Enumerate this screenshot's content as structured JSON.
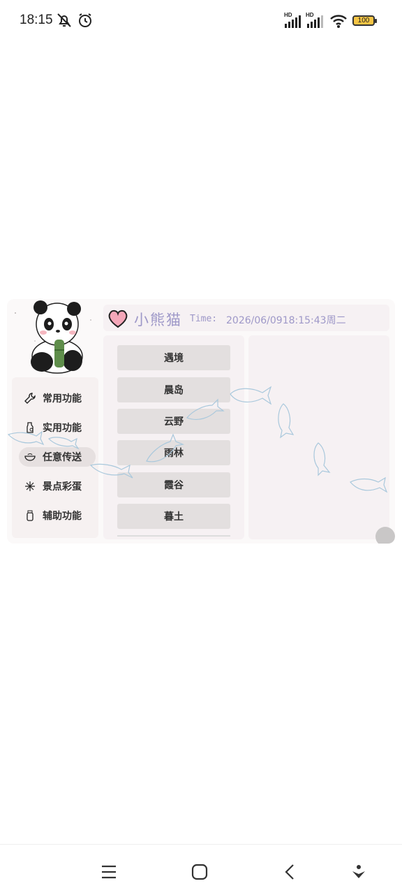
{
  "status_bar": {
    "time": "18:15",
    "hd1": "HD",
    "hd2": "HD",
    "battery": "100",
    "icons": [
      "bell-muted-icon",
      "alarm-icon",
      "signal-icon",
      "signal-icon",
      "wifi-icon",
      "battery-icon"
    ]
  },
  "header": {
    "title": "小熊猫",
    "time_label": "Time:",
    "time_value": "2026/06/0918:15:43周二",
    "heart_color": "#f4a7b9"
  },
  "sidebar": {
    "items": [
      {
        "label": "常用功能",
        "icon": "wrench-icon"
      },
      {
        "label": "实用功能",
        "icon": "bottle-icon"
      },
      {
        "label": "任意传送",
        "icon": "bowl-icon",
        "active": true
      },
      {
        "label": "景点彩蛋",
        "icon": "sparkle-icon"
      },
      {
        "label": "辅助功能",
        "icon": "jar-icon"
      }
    ]
  },
  "destinations": [
    "遇境",
    "晨岛",
    "云野",
    "雨林",
    "霞谷",
    "暮土"
  ],
  "nav_bar": {
    "icons": [
      "menu-icon",
      "home-icon",
      "back-icon",
      "assistant-icon"
    ]
  },
  "colors": {
    "accent_text": "#9e98c8",
    "button_bg": "#e3dfdf",
    "panel_bg": "#fbf9f9"
  }
}
